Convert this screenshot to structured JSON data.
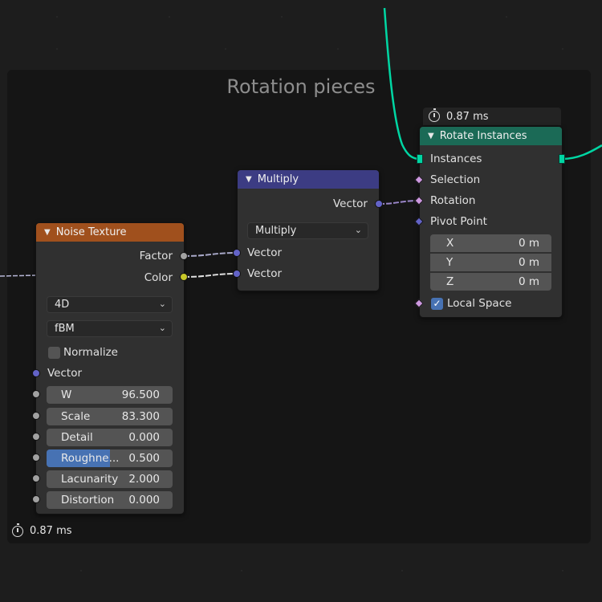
{
  "frame": {
    "title": "Rotation pieces"
  },
  "timings": {
    "frame_timing": "0.87 ms",
    "rotate_timing": "0.87 ms"
  },
  "colors": {
    "noise_header": "#a0501d",
    "multiply_header": "#3c3c83",
    "rotate_header": "#1b6a56",
    "geometry_wire": "#00d6a3",
    "vector_socket": "#6363c7",
    "float_socket": "#a1a1a1",
    "color_socket": "#c7c729",
    "rotation_socket": "#cd98e0",
    "accent_blue": "#4772b3"
  },
  "noise_texture": {
    "title": "Noise Texture",
    "outputs": {
      "factor": "Factor",
      "color": "Color"
    },
    "dimensions": "4D",
    "type": "fBM",
    "normalize_label": "Normalize",
    "normalize_checked": false,
    "vector_label": "Vector",
    "fields": [
      {
        "label": "W",
        "value": "96.500"
      },
      {
        "label": "Scale",
        "value": "83.300"
      },
      {
        "label": "Detail",
        "value": "0.000"
      },
      {
        "label": "Roughne...",
        "value": "0.500",
        "fill": 0.5
      },
      {
        "label": "Lacunarity",
        "value": "2.000"
      },
      {
        "label": "Distortion",
        "value": "0.000"
      }
    ]
  },
  "multiply": {
    "title": "Multiply",
    "output": "Vector",
    "operation": "Multiply",
    "inputs": [
      "Vector",
      "Vector"
    ]
  },
  "rotate_instances": {
    "title": "Rotate Instances",
    "inputs": {
      "instances": "Instances",
      "selection": "Selection",
      "rotation": "Rotation",
      "pivot_point": "Pivot Point"
    },
    "pivot": [
      {
        "label": "X",
        "value": "0 m"
      },
      {
        "label": "Y",
        "value": "0 m"
      },
      {
        "label": "Z",
        "value": "0 m"
      }
    ],
    "local_space_label": "Local Space",
    "local_space_checked": true
  }
}
